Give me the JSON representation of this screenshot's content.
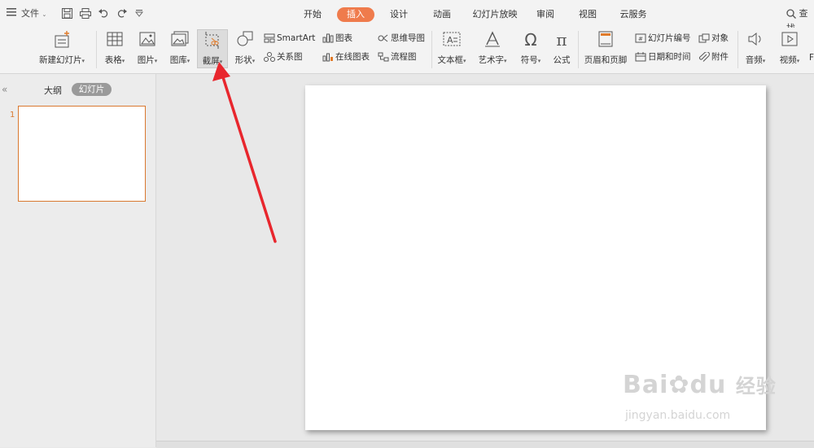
{
  "titlebar": {
    "menu_label": "文件",
    "tabs": [
      {
        "label": "开始",
        "active": false
      },
      {
        "label": "插入",
        "active": true
      },
      {
        "label": "设计",
        "active": false
      },
      {
        "label": "动画",
        "active": false
      },
      {
        "label": "幻灯片放映",
        "active": false
      },
      {
        "label": "审阅",
        "active": false
      },
      {
        "label": "视图",
        "active": false
      },
      {
        "label": "云服务",
        "active": false
      }
    ],
    "search_label": "查找"
  },
  "ribbon": {
    "new_slide": "新建幻灯片",
    "table": "表格",
    "picture": "图片",
    "gallery": "图库",
    "screenshot": "截屏",
    "shapes": "形状",
    "smartart": "SmartArt",
    "chart": "图表",
    "relation": "关系图",
    "online_chart": "在线图表",
    "mindmap": "思维导图",
    "flowchart": "流程图",
    "textbox": "文本框",
    "wordart": "艺术字",
    "symbol": "符号",
    "formula": "公式",
    "header_footer": "页眉和页脚",
    "slide_number": "幻灯片编号",
    "object": "对象",
    "datetime": "日期和时间",
    "attachment": "附件",
    "audio": "音频",
    "video": "视频",
    "cutoff_label": "F"
  },
  "left_panel": {
    "outline_tab": "大纲",
    "slides_tab": "幻灯片",
    "slide_index": "1"
  },
  "watermark": {
    "brand": "Bai",
    "brand2": "du",
    "cn": "经验",
    "url": "jingyan.baidu.com"
  },
  "colors": {
    "accent": "#ef7b4c",
    "thumb_border": "#d9782f",
    "arrow": "#e8262d"
  }
}
